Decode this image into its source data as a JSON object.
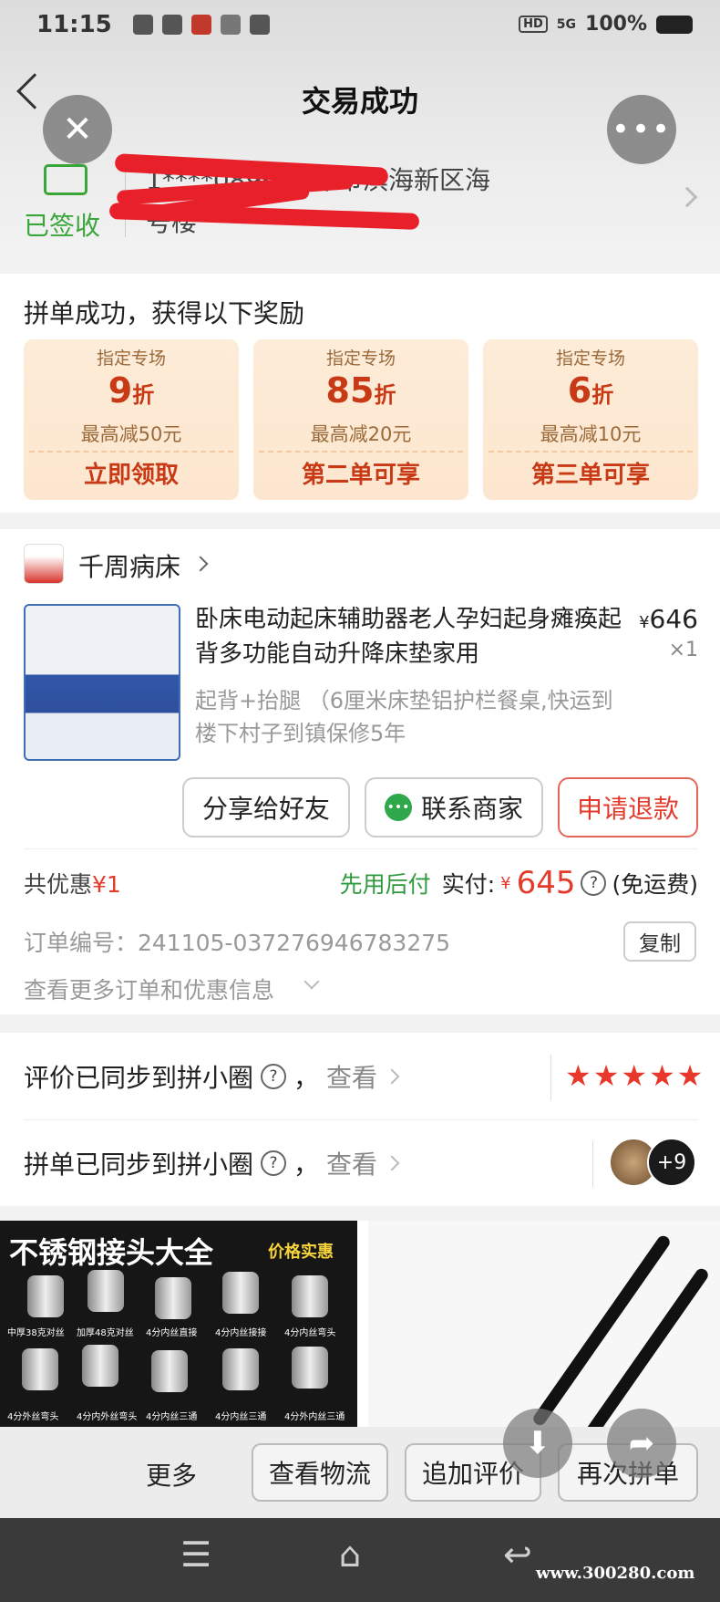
{
  "status_bar": {
    "time": "11:15",
    "network": "5G",
    "battery": "100%"
  },
  "header": {
    "title": "交易成功"
  },
  "delivery": {
    "status": "已签收",
    "address_line1": "1****0896  天津市滨海新区海",
    "address_line2": "号楼"
  },
  "rewards": {
    "title": "拼单成功，获得以下奖励",
    "coupons": [
      {
        "tag": "指定专场",
        "discount": "9",
        "unit": "折",
        "max": "最高减50元",
        "action": "立即领取"
      },
      {
        "tag": "指定专场",
        "discount": "85",
        "unit": "折",
        "max": "最高减20元",
        "action": "第二单可享"
      },
      {
        "tag": "指定专场",
        "discount": "6",
        "unit": "折",
        "max": "最高减10元",
        "action": "第三单可享"
      }
    ]
  },
  "shop": {
    "name": "千周病床"
  },
  "product": {
    "title": "卧床电动起床辅助器老人孕妇起身瘫痪起背多功能自动升降床垫家用",
    "currency": "¥",
    "price": "646",
    "quantity": "×1",
    "spec": "起背+抬腿 （6厘米床垫铝护栏餐桌,快运到楼下村子到镇保修5年"
  },
  "actions": {
    "share": "分享给好友",
    "contact": "联系商家",
    "refund": "申请退款"
  },
  "payment": {
    "saving_label": "共优惠",
    "saving_value": "¥1",
    "pay_later": "先用后付",
    "paid_label": "实付:",
    "currency": "¥",
    "paid_amount": "645",
    "help": "?",
    "shipping": "(免运费)"
  },
  "order": {
    "number_text": "订单编号：241105-037276946783275",
    "copy": "复制",
    "more_info": "查看更多订单和优惠信息"
  },
  "sync": {
    "review_text": "评价已同步到拼小圈",
    "group_text": "拼单已同步到拼小圈",
    "help": "?",
    "comma": "，",
    "view": "查看",
    "stars": "★★★★★",
    "extra_count": "+9"
  },
  "recommendations": {
    "rec1_title": "不锈钢接头大全",
    "rec1_tag": "价格实惠",
    "rec1_labels": [
      "中厚38克对丝",
      "加厚48克对丝",
      "4分内丝直接",
      "4分内丝接接",
      "4分内丝弯头",
      "4分外丝弯头",
      "4分内外丝弯头",
      "4分内丝三通",
      "4分内丝三通",
      "4分外内丝三通"
    ]
  },
  "bottom_bar": {
    "more": "更多",
    "logistics": "查看物流",
    "add_review": "追加评价",
    "reorder": "再次拼单"
  },
  "watermark": "www.300280.com",
  "colors": {
    "accent_red": "#e23b2b",
    "green": "#3aa63a",
    "coupon_bg": "#fdecd8"
  }
}
